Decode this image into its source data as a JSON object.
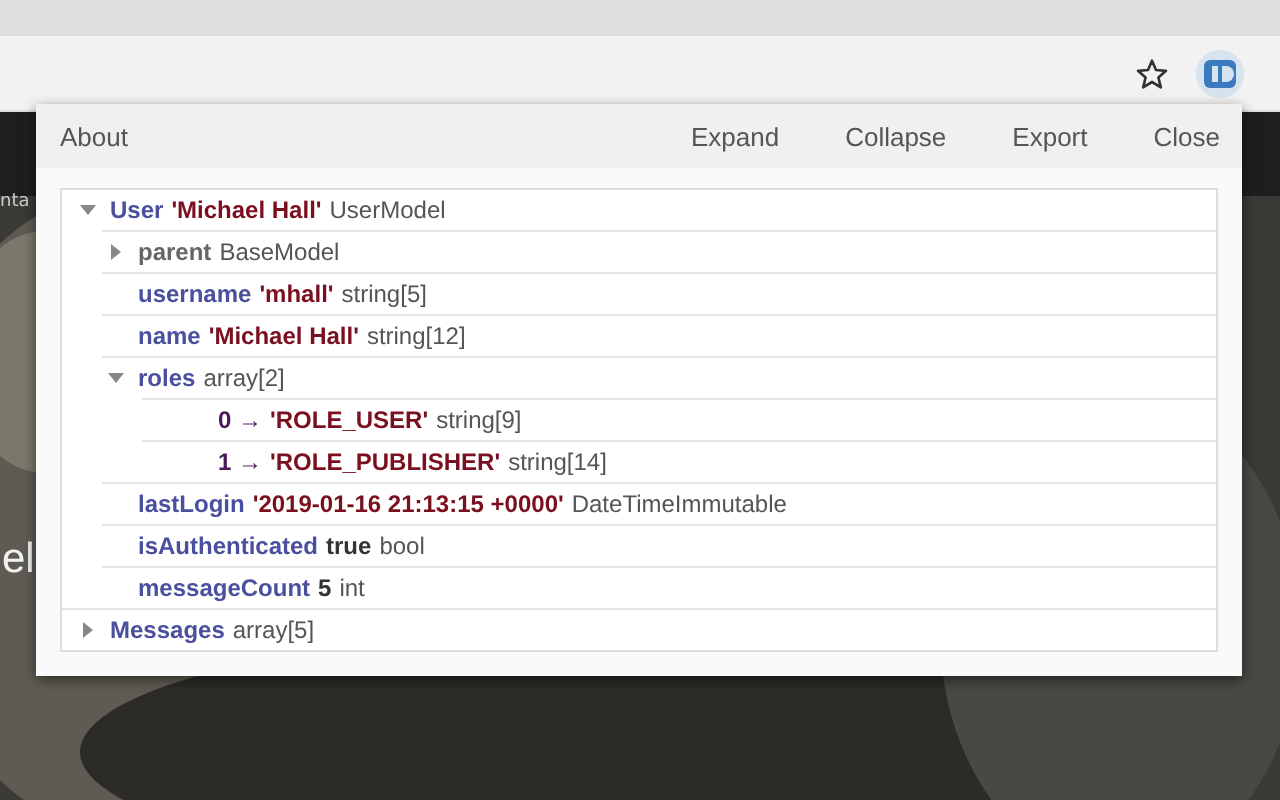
{
  "page": {
    "nav_fragment": "nta",
    "heading_fragment": "el"
  },
  "popup": {
    "menu_left": [
      "About"
    ],
    "menu_right": [
      "Expand",
      "Collapse",
      "Export",
      "Close"
    ],
    "tree": [
      {
        "kind": "property",
        "key": "User",
        "value": {
          "text": "'Michael Hall'",
          "kind": "string"
        },
        "type": "UserModel",
        "expanded": true,
        "children": [
          {
            "kind": "inherited",
            "key": "parent",
            "type": "BaseModel",
            "expanded": false
          },
          {
            "kind": "property",
            "key": "username",
            "value": {
              "text": "'mhall'",
              "kind": "string"
            },
            "type": "string[5]"
          },
          {
            "kind": "property",
            "key": "name",
            "value": {
              "text": "'Michael Hall'",
              "kind": "string"
            },
            "type": "string[12]"
          },
          {
            "kind": "property",
            "key": "roles",
            "type": "array[2]",
            "expanded": true,
            "children": [
              {
                "kind": "index",
                "key": "0 →",
                "value": {
                  "text": "'ROLE_USER'",
                  "kind": "string"
                },
                "type": "string[9]"
              },
              {
                "kind": "index",
                "key": "1 →",
                "value": {
                  "text": "'ROLE_PUBLISHER'",
                  "kind": "string"
                },
                "type": "string[14]"
              }
            ]
          },
          {
            "kind": "property",
            "key": "lastLogin",
            "value": {
              "text": "'2019-01-16 21:13:15 +0000'",
              "kind": "string"
            },
            "type": "DateTimeImmutable"
          },
          {
            "kind": "property",
            "key": "isAuthenticated",
            "value": {
              "text": "true",
              "kind": "scalar"
            },
            "type": "bool"
          },
          {
            "kind": "property",
            "key": "messageCount",
            "value": {
              "text": "5",
              "kind": "scalar"
            },
            "type": "int"
          }
        ]
      },
      {
        "kind": "property",
        "key": "Messages",
        "type": "array[5]",
        "expanded": false
      }
    ]
  }
}
